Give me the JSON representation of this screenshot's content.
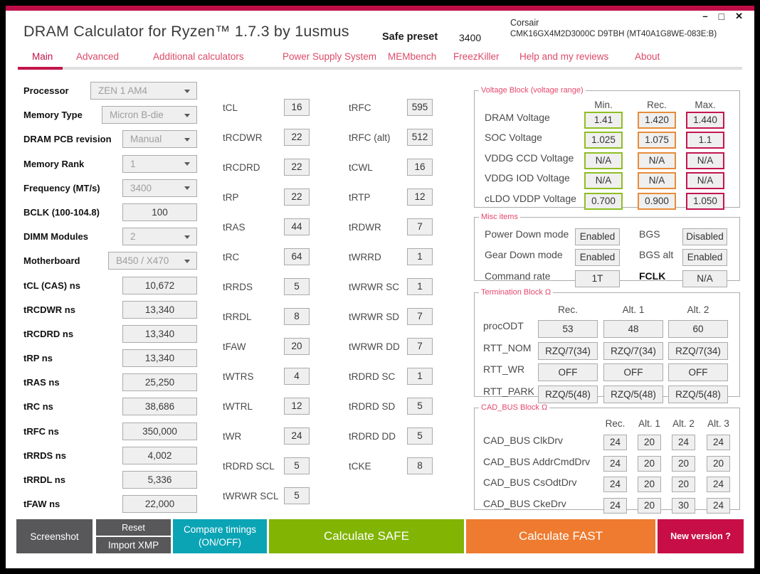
{
  "colors": {
    "brand_strip": "#C00D47",
    "nav_active": "#C2154A",
    "nav_inactive": "#DC4A68",
    "group_title": "#E4476B",
    "voltage_min_border": "#8FBE22",
    "voltage_rec_border": "#E78C3A",
    "voltage_max_border": "#C2164F",
    "button_gray": "#58585A",
    "button_teal": "#0AA4B5",
    "button_green": "#81B403",
    "button_orange": "#EE7B2F",
    "button_crimson": "#C80E46",
    "field_bg": "#EFEFEF",
    "field_border": "#ABABAB"
  },
  "window": {
    "title": "DRAM Calculator for Ryzen™ 1.7.3 by 1usmus",
    "preset_label": "Safe preset",
    "preset_value": "3400",
    "module_brand": "Corsair",
    "module_part": "CMK16GX4M2D3000C D9TBH (MT40A1G8WE-083E:B)",
    "minimize": "–",
    "maximize": "□",
    "close": "✕"
  },
  "nav": {
    "tabs": [
      {
        "label": "Main"
      },
      {
        "label": "Advanced"
      },
      {
        "label": "Additional calculators"
      },
      {
        "label": "Power Supply System"
      },
      {
        "label": "MEMbench"
      },
      {
        "label": "FreezKiller"
      },
      {
        "label": "Help and my reviews"
      },
      {
        "label": "About"
      }
    ]
  },
  "left": {
    "fields": [
      {
        "label": "Processor",
        "value": "ZEN 1 AM4"
      },
      {
        "label": "Memory Type",
        "value": "Micron B-die"
      },
      {
        "label": "DRAM PCB revision",
        "value": "Manual"
      },
      {
        "label": "Memory Rank",
        "value": "1"
      },
      {
        "label": "Frequency (MT/s)",
        "value": "3400"
      },
      {
        "label": "BCLK (100-104.8)",
        "value": "100"
      },
      {
        "label": "DIMM Modules",
        "value": "2"
      },
      {
        "label": "Motherboard",
        "value": "B450 / X470"
      },
      {
        "label": "tCL (CAS) ns",
        "value": "10,672"
      },
      {
        "label": "tRCDWR ns",
        "value": "13,340"
      },
      {
        "label": "tRCDRD ns",
        "value": "13,340"
      },
      {
        "label": "tRP ns",
        "value": "13,340"
      },
      {
        "label": "tRAS ns",
        "value": "25,250"
      },
      {
        "label": "tRC ns",
        "value": "38,686"
      },
      {
        "label": "tRFC ns",
        "value": "350,000"
      },
      {
        "label": "tRRDS ns",
        "value": "4,002"
      },
      {
        "label": "tRRDL ns",
        "value": "5,336"
      },
      {
        "label": "tFAW ns",
        "value": "22,000"
      }
    ]
  },
  "col1": {
    "rows": [
      {
        "label": "tCL",
        "value": "16"
      },
      {
        "label": "tRCDWR",
        "value": "22"
      },
      {
        "label": "tRCDRD",
        "value": "22"
      },
      {
        "label": "tRP",
        "value": "22"
      },
      {
        "label": "tRAS",
        "value": "44"
      },
      {
        "label": "tRC",
        "value": "64"
      },
      {
        "label": "tRRDS",
        "value": "5"
      },
      {
        "label": "tRRDL",
        "value": "8"
      },
      {
        "label": "tFAW",
        "value": "20"
      },
      {
        "label": "tWTRS",
        "value": "4"
      },
      {
        "label": "tWTRL",
        "value": "12"
      },
      {
        "label": "tWR",
        "value": "24"
      },
      {
        "label": "tRDRD SCL",
        "value": "5"
      },
      {
        "label": "tWRWR SCL",
        "value": "5"
      }
    ]
  },
  "col2": {
    "rows": [
      {
        "label": "tRFC",
        "value": "595"
      },
      {
        "label": "tRFC (alt)",
        "value": "512"
      },
      {
        "label": "tCWL",
        "value": "16"
      },
      {
        "label": "tRTP",
        "value": "12"
      },
      {
        "label": "tRDWR",
        "value": "7"
      },
      {
        "label": "tWRRD",
        "value": "1"
      },
      {
        "label": "tWRWR SC",
        "value": "1"
      },
      {
        "label": "tWRWR SD",
        "value": "7"
      },
      {
        "label": "tWRWR DD",
        "value": "7"
      },
      {
        "label": "tRDRD SC",
        "value": "1"
      },
      {
        "label": "tRDRD SD",
        "value": "5"
      },
      {
        "label": "tRDRD DD",
        "value": "5"
      },
      {
        "label": "tCKE",
        "value": "8"
      }
    ]
  },
  "voltage": {
    "title": "Voltage Block (voltage range)",
    "headers": [
      "Min.",
      "Rec.",
      "Max."
    ],
    "rows": [
      {
        "label": "DRAM Voltage",
        "min": "1.41",
        "rec": "1.420",
        "max": "1.440"
      },
      {
        "label": "SOC Voltage",
        "min": "1.025",
        "rec": "1.075",
        "max": "1.1"
      },
      {
        "label": "VDDG CCD Voltage",
        "min": "N/A",
        "rec": "N/A",
        "max": "N/A"
      },
      {
        "label": "VDDG IOD Voltage",
        "min": "N/A",
        "rec": "N/A",
        "max": "N/A"
      },
      {
        "label": "cLDO VDDP Voltage",
        "min": "0.700",
        "rec": "0.900",
        "max": "1.050"
      }
    ]
  },
  "misc": {
    "title": "Misc items",
    "rows": [
      {
        "label": "Power Down mode",
        "value": "Enabled",
        "label2": "BGS",
        "value2": "Disabled"
      },
      {
        "label": "Gear Down mode",
        "value": "Enabled",
        "label2": "BGS alt",
        "value2": "Enabled"
      },
      {
        "label": "Command rate",
        "value": "1T",
        "label2": "FCLK",
        "value2": "N/A"
      }
    ]
  },
  "termination": {
    "title": "Termination Block Ω",
    "headers": [
      "Rec.",
      "Alt. 1",
      "Alt. 2"
    ],
    "rows": [
      {
        "label": "procODT",
        "values": [
          "53",
          "48",
          "60"
        ]
      },
      {
        "label": "RTT_NOM",
        "values": [
          "RZQ/7(34)",
          "RZQ/7(34)",
          "RZQ/7(34)"
        ]
      },
      {
        "label": "RTT_WR",
        "values": [
          "OFF",
          "OFF",
          "OFF"
        ]
      },
      {
        "label": "RTT_PARK",
        "values": [
          "RZQ/5(48)",
          "RZQ/5(48)",
          "RZQ/5(48)"
        ]
      }
    ]
  },
  "cadbus": {
    "title": "CAD_BUS Block Ω",
    "headers": [
      "Rec.",
      "Alt. 1",
      "Alt. 2",
      "Alt. 3"
    ],
    "rows": [
      {
        "label": "CAD_BUS ClkDrv",
        "values": [
          "24",
          "20",
          "24",
          "24"
        ]
      },
      {
        "label": "CAD_BUS AddrCmdDrv",
        "values": [
          "24",
          "20",
          "20",
          "20"
        ]
      },
      {
        "label": "CAD_BUS CsOdtDrv",
        "values": [
          "24",
          "20",
          "20",
          "24"
        ]
      },
      {
        "label": "CAD_BUS CkeDrv",
        "values": [
          "24",
          "20",
          "30",
          "24"
        ]
      }
    ]
  },
  "footer": {
    "screenshot": "Screenshot",
    "reset": "Reset",
    "import_xmp": "Import XMP",
    "compare_line1": "Compare timings",
    "compare_line2": "(ON/OFF)",
    "calculate_safe": "Calculate SAFE",
    "calculate_fast": "Calculate FAST",
    "new_version": "New version ?"
  }
}
